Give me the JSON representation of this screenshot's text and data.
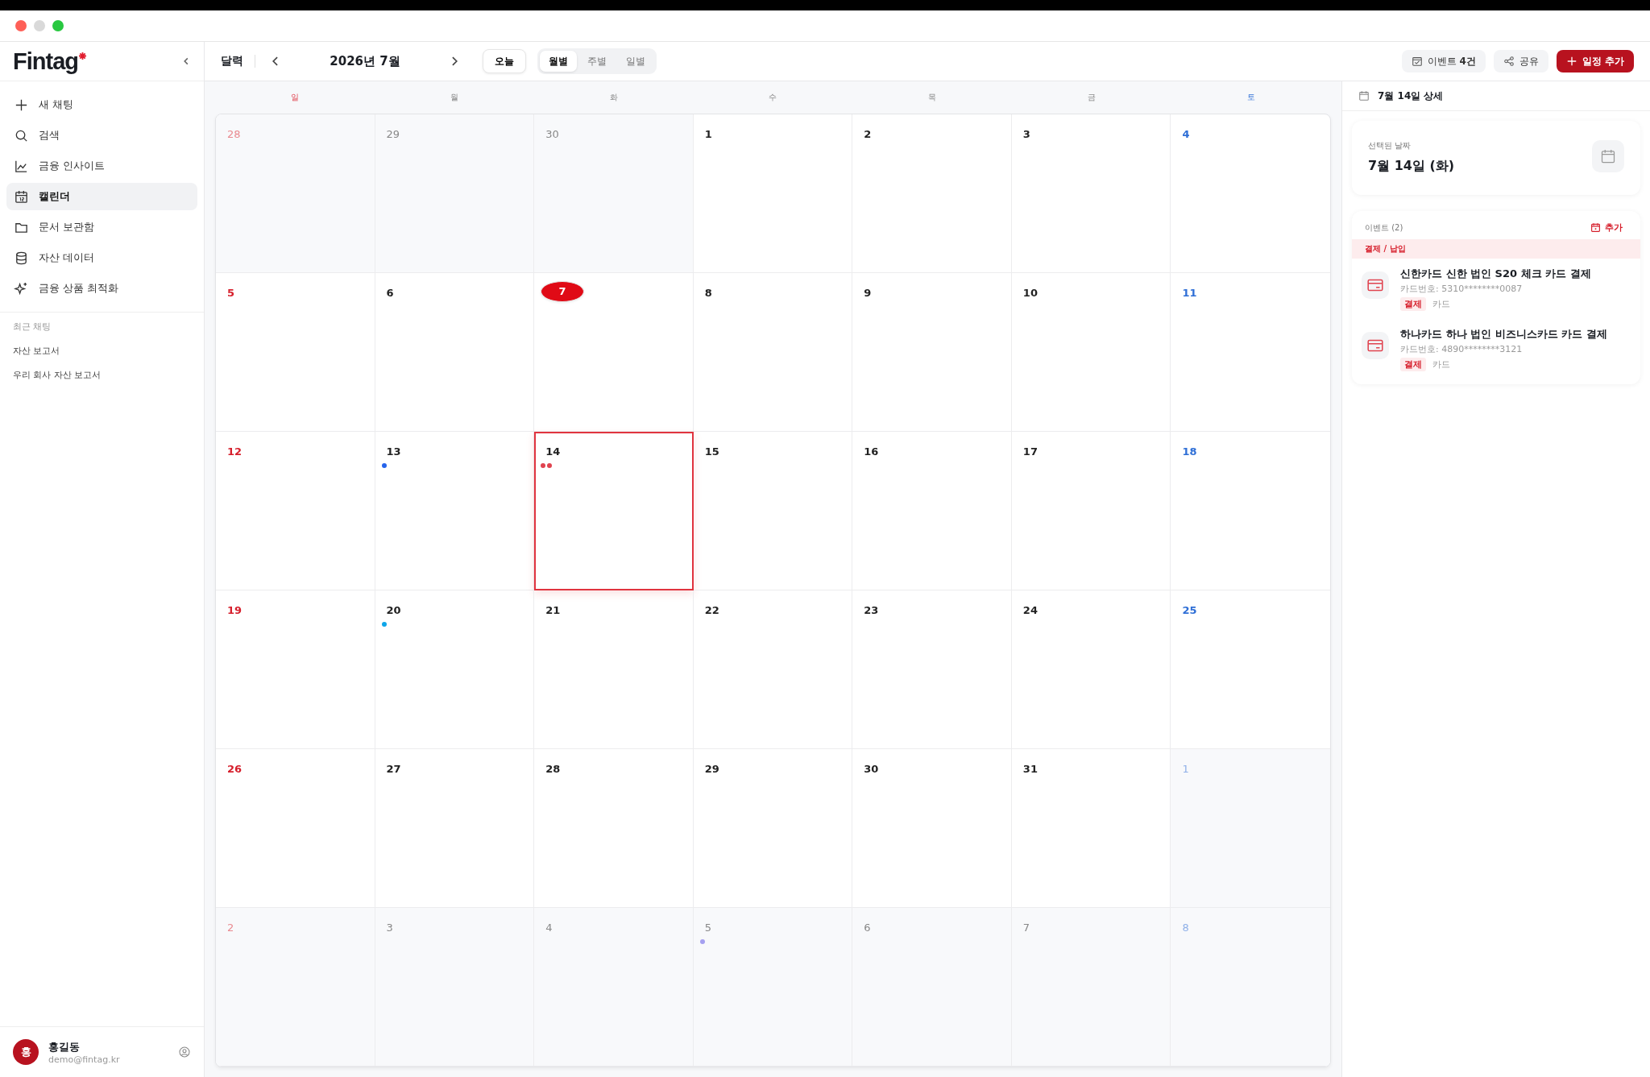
{
  "sidebar": {
    "logo": "Fintag",
    "items": [
      {
        "label": "새 채팅",
        "selected": false
      },
      {
        "label": "검색",
        "selected": false
      },
      {
        "label": "금융 인사이트",
        "selected": false
      },
      {
        "label": "캘린더",
        "selected": true
      },
      {
        "label": "문서 보관함",
        "selected": false
      },
      {
        "label": "자산 데이터",
        "selected": false
      },
      {
        "label": "금융 상품 최적화",
        "selected": false
      }
    ],
    "recent_heading": "최근 채팅",
    "recent": [
      "자산 보고서",
      "우리 회사 자산 보고서"
    ],
    "user": {
      "avatar": "홍",
      "name": "홍길동",
      "email": "demo@fintag.kr"
    }
  },
  "header": {
    "title": "달력",
    "month": "2026년 7월",
    "today_button": "오늘",
    "views": [
      {
        "label": "월별",
        "selected": true
      },
      {
        "label": "주별",
        "selected": false
      },
      {
        "label": "일별",
        "selected": false
      }
    ],
    "event_count": "이벤트 **4건**",
    "share": "공유",
    "add": "일정 추가"
  },
  "calendar": {
    "weekdays": [
      "일",
      "월",
      "화",
      "수",
      "목",
      "금",
      "토"
    ],
    "days": [
      {
        "label": "28",
        "outside": true
      },
      {
        "label": "29",
        "outside": true
      },
      {
        "label": "30",
        "outside": true
      },
      {
        "label": "1",
        "outside": false
      },
      {
        "label": "2",
        "outside": false
      },
      {
        "label": "3",
        "outside": false
      },
      {
        "label": "4",
        "outside": false
      },
      {
        "label": "5",
        "outside": false
      },
      {
        "label": "6",
        "outside": false
      },
      {
        "label": "7",
        "outside": false,
        "today": true
      },
      {
        "label": "8",
        "outside": false
      },
      {
        "label": "9",
        "outside": false
      },
      {
        "label": "10",
        "outside": false
      },
      {
        "label": "11",
        "outside": false
      },
      {
        "label": "12",
        "outside": false
      },
      {
        "label": "13",
        "outside": false,
        "dots": [
          {
            "color": "#2563eb"
          }
        ]
      },
      {
        "label": "14",
        "outside": false,
        "selected": true,
        "dots": [
          {
            "color": "#e0434f"
          },
          {
            "color": "#e0434f"
          }
        ]
      },
      {
        "label": "15",
        "outside": false
      },
      {
        "label": "16",
        "outside": false
      },
      {
        "label": "17",
        "outside": false
      },
      {
        "label": "18",
        "outside": false
      },
      {
        "label": "19",
        "outside": false
      },
      {
        "label": "20",
        "outside": false,
        "dots": [
          {
            "color": "#0ea5e9"
          }
        ]
      },
      {
        "label": "21",
        "outside": false
      },
      {
        "label": "22",
        "outside": false
      },
      {
        "label": "23",
        "outside": false
      },
      {
        "label": "24",
        "outside": false
      },
      {
        "label": "25",
        "outside": false
      },
      {
        "label": "26",
        "outside": false
      },
      {
        "label": "27",
        "outside": false
      },
      {
        "label": "28",
        "outside": false
      },
      {
        "label": "29",
        "outside": false
      },
      {
        "label": "30",
        "outside": false
      },
      {
        "label": "31",
        "outside": false
      },
      {
        "label": "1",
        "outside": true
      },
      {
        "label": "2",
        "outside": true
      },
      {
        "label": "3",
        "outside": true
      },
      {
        "label": "4",
        "outside": true
      },
      {
        "label": "5",
        "outside": true,
        "dots": [
          {
            "color": "#a5a0f0"
          }
        ]
      },
      {
        "label": "6",
        "outside": true
      },
      {
        "label": "7",
        "outside": true
      },
      {
        "label": "8",
        "outside": true
      }
    ]
  },
  "detail": {
    "title": "7월 14일 상세",
    "date_label": "선택된 날짜",
    "date": "7월 14일 (화)",
    "events_heading": "이벤트 (2)",
    "add": "추가",
    "group": "결제 / 납입",
    "events": [
      {
        "title": "신한카드 신한 법인 S20 체크 카드 결제",
        "sub": "카드번호: 5310********0087",
        "tag": "결제",
        "category": "카드"
      },
      {
        "title": "하나카드 하나 법인 비즈니스카드 카드 결제",
        "sub": "카드번호: 4890********3121",
        "tag": "결제",
        "category": "카드"
      }
    ]
  }
}
